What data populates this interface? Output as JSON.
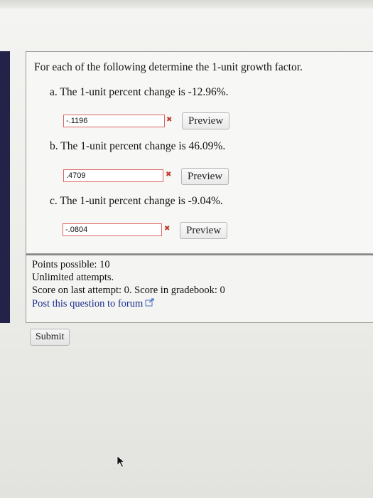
{
  "question": {
    "intro": "For each of the following determine the 1-unit growth factor.",
    "parts": [
      {
        "label": "a. The 1-unit percent change is -12.96%.",
        "answer": "-.1196",
        "status": "incorrect",
        "status_icon": "red-x-icon",
        "preview_label": "Preview"
      },
      {
        "label": "b. The 1-unit percent change is 46.09%.",
        "answer": ".4709",
        "status": "incorrect",
        "status_icon": "red-x-icon",
        "preview_label": "Preview"
      },
      {
        "label": "c. The 1-unit percent change is -9.04%.",
        "answer": "-.0804",
        "status": "incorrect",
        "status_icon": "red-x-icon",
        "preview_label": "Preview"
      }
    ]
  },
  "info": {
    "points": "Points possible: 10",
    "attempts": "Unlimited attempts.",
    "score": "Score on last attempt: 0. Score in gradebook: 0",
    "forum_link": "Post this question to forum",
    "forum_icon": "external-link-icon"
  },
  "submit_label": "Submit",
  "colors": {
    "error": "#c0392b",
    "link": "#1c2f8f",
    "sidebar": "#23234a"
  }
}
